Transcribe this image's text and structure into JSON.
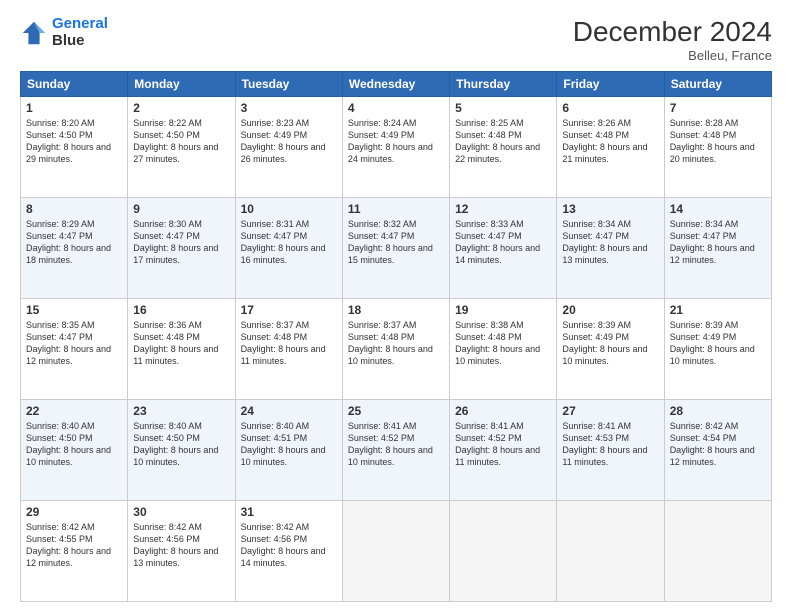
{
  "header": {
    "logo_line1": "General",
    "logo_line2": "Blue",
    "month": "December 2024",
    "location": "Belleu, France"
  },
  "weekdays": [
    "Sunday",
    "Monday",
    "Tuesday",
    "Wednesday",
    "Thursday",
    "Friday",
    "Saturday"
  ],
  "weeks": [
    [
      {
        "day": "1",
        "sunrise": "8:20 AM",
        "sunset": "4:50 PM",
        "daylight": "8 hours and 29 minutes."
      },
      {
        "day": "2",
        "sunrise": "8:22 AM",
        "sunset": "4:50 PM",
        "daylight": "8 hours and 27 minutes."
      },
      {
        "day": "3",
        "sunrise": "8:23 AM",
        "sunset": "4:49 PM",
        "daylight": "8 hours and 26 minutes."
      },
      {
        "day": "4",
        "sunrise": "8:24 AM",
        "sunset": "4:49 PM",
        "daylight": "8 hours and 24 minutes."
      },
      {
        "day": "5",
        "sunrise": "8:25 AM",
        "sunset": "4:48 PM",
        "daylight": "8 hours and 22 minutes."
      },
      {
        "day": "6",
        "sunrise": "8:26 AM",
        "sunset": "4:48 PM",
        "daylight": "8 hours and 21 minutes."
      },
      {
        "day": "7",
        "sunrise": "8:28 AM",
        "sunset": "4:48 PM",
        "daylight": "8 hours and 20 minutes."
      }
    ],
    [
      {
        "day": "8",
        "sunrise": "8:29 AM",
        "sunset": "4:47 PM",
        "daylight": "8 hours and 18 minutes."
      },
      {
        "day": "9",
        "sunrise": "8:30 AM",
        "sunset": "4:47 PM",
        "daylight": "8 hours and 17 minutes."
      },
      {
        "day": "10",
        "sunrise": "8:31 AM",
        "sunset": "4:47 PM",
        "daylight": "8 hours and 16 minutes."
      },
      {
        "day": "11",
        "sunrise": "8:32 AM",
        "sunset": "4:47 PM",
        "daylight": "8 hours and 15 minutes."
      },
      {
        "day": "12",
        "sunrise": "8:33 AM",
        "sunset": "4:47 PM",
        "daylight": "8 hours and 14 minutes."
      },
      {
        "day": "13",
        "sunrise": "8:34 AM",
        "sunset": "4:47 PM",
        "daylight": "8 hours and 13 minutes."
      },
      {
        "day": "14",
        "sunrise": "8:34 AM",
        "sunset": "4:47 PM",
        "daylight": "8 hours and 12 minutes."
      }
    ],
    [
      {
        "day": "15",
        "sunrise": "8:35 AM",
        "sunset": "4:47 PM",
        "daylight": "8 hours and 12 minutes."
      },
      {
        "day": "16",
        "sunrise": "8:36 AM",
        "sunset": "4:48 PM",
        "daylight": "8 hours and 11 minutes."
      },
      {
        "day": "17",
        "sunrise": "8:37 AM",
        "sunset": "4:48 PM",
        "daylight": "8 hours and 11 minutes."
      },
      {
        "day": "18",
        "sunrise": "8:37 AM",
        "sunset": "4:48 PM",
        "daylight": "8 hours and 10 minutes."
      },
      {
        "day": "19",
        "sunrise": "8:38 AM",
        "sunset": "4:48 PM",
        "daylight": "8 hours and 10 minutes."
      },
      {
        "day": "20",
        "sunrise": "8:39 AM",
        "sunset": "4:49 PM",
        "daylight": "8 hours and 10 minutes."
      },
      {
        "day": "21",
        "sunrise": "8:39 AM",
        "sunset": "4:49 PM",
        "daylight": "8 hours and 10 minutes."
      }
    ],
    [
      {
        "day": "22",
        "sunrise": "8:40 AM",
        "sunset": "4:50 PM",
        "daylight": "8 hours and 10 minutes."
      },
      {
        "day": "23",
        "sunrise": "8:40 AM",
        "sunset": "4:50 PM",
        "daylight": "8 hours and 10 minutes."
      },
      {
        "day": "24",
        "sunrise": "8:40 AM",
        "sunset": "4:51 PM",
        "daylight": "8 hours and 10 minutes."
      },
      {
        "day": "25",
        "sunrise": "8:41 AM",
        "sunset": "4:52 PM",
        "daylight": "8 hours and 10 minutes."
      },
      {
        "day": "26",
        "sunrise": "8:41 AM",
        "sunset": "4:52 PM",
        "daylight": "8 hours and 11 minutes."
      },
      {
        "day": "27",
        "sunrise": "8:41 AM",
        "sunset": "4:53 PM",
        "daylight": "8 hours and 11 minutes."
      },
      {
        "day": "28",
        "sunrise": "8:42 AM",
        "sunset": "4:54 PM",
        "daylight": "8 hours and 12 minutes."
      }
    ],
    [
      {
        "day": "29",
        "sunrise": "8:42 AM",
        "sunset": "4:55 PM",
        "daylight": "8 hours and 12 minutes."
      },
      {
        "day": "30",
        "sunrise": "8:42 AM",
        "sunset": "4:56 PM",
        "daylight": "8 hours and 13 minutes."
      },
      {
        "day": "31",
        "sunrise": "8:42 AM",
        "sunset": "4:56 PM",
        "daylight": "8 hours and 14 minutes."
      },
      null,
      null,
      null,
      null
    ]
  ]
}
